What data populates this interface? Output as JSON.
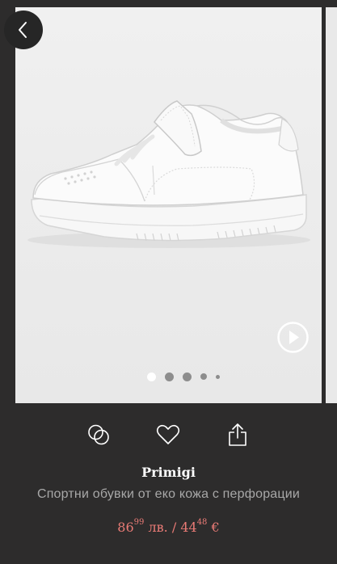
{
  "product": {
    "brand": "Primigi",
    "title": "Спортни обувки от еко кожа с перфорации",
    "price_bgn_main": "86",
    "price_bgn_cents": "99",
    "price_bgn_currency": "лв.",
    "price_separator": "/",
    "price_eur_main": "44",
    "price_eur_cents": "48",
    "price_eur_currency": "€"
  },
  "gallery": {
    "image_count": 5,
    "active_index": 0
  },
  "icons": {
    "back": "chevron-left-icon",
    "play": "play-circle-icon",
    "compare": "compare-circles-icon",
    "wishlist": "heart-icon",
    "share": "share-icon"
  },
  "colors": {
    "background": "#2d2c2c",
    "price": "#ea7b76",
    "brand": "#ffffff",
    "title": "#a8a8a8"
  }
}
